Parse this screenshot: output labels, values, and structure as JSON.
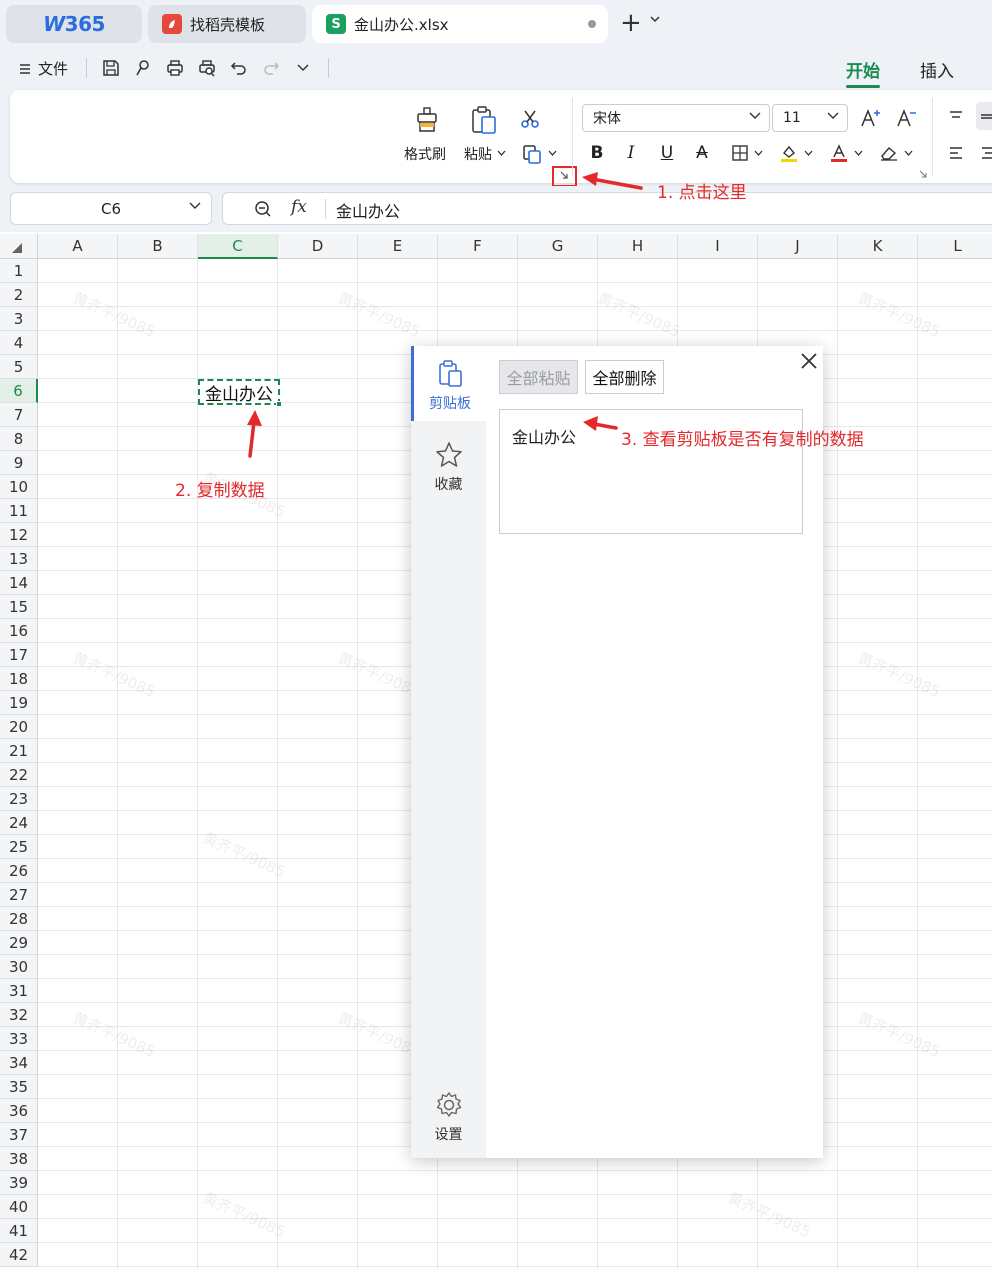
{
  "tabs": [
    {
      "label": "365",
      "logo": "W"
    },
    {
      "label": "找稻壳模板",
      "icon": "docer-icon"
    },
    {
      "label": "金山办公.xlsx",
      "icon": "S"
    }
  ],
  "menu": {
    "file_label": "文件",
    "tabs": [
      "开始",
      "插入"
    ],
    "active_tab": "开始"
  },
  "ribbon": {
    "format_painter": "格式刷",
    "paste": "粘贴",
    "font_name": "宋体",
    "font_size": "11"
  },
  "formula_bar": {
    "cell_ref": "C6",
    "fx": "fx",
    "value": "金山办公"
  },
  "grid": {
    "columns": [
      "A",
      "B",
      "C",
      "D",
      "E",
      "F",
      "G",
      "H",
      "I",
      "J",
      "K",
      "L"
    ],
    "rows": [
      "1",
      "2",
      "3",
      "4",
      "5",
      "6",
      "7",
      "8",
      "9",
      "10",
      "11",
      "12",
      "13",
      "14",
      "15",
      "16",
      "17",
      "18",
      "19",
      "20",
      "21",
      "22",
      "23",
      "24",
      "25",
      "26",
      "27",
      "28",
      "29",
      "30",
      "31",
      "32",
      "33",
      "34",
      "35",
      "36",
      "37",
      "38",
      "39",
      "40",
      "41",
      "42"
    ],
    "selected_col": "C",
    "selected_row": "6",
    "cell_c6": "金山办公",
    "watermark": "黄齐平/9085"
  },
  "clipboard_panel": {
    "side": {
      "clipboard": "剪贴板",
      "favorites": "收藏",
      "settings": "设置"
    },
    "paste_all": "全部粘贴",
    "delete_all": "全部删除",
    "items": [
      "金山办公"
    ]
  },
  "annotations": {
    "step1": "1. 点击这里",
    "step2": "2. 复制数据",
    "step3": "3. 查看剪贴板是否有复制的数据"
  },
  "colors": {
    "accent_green": "#1a8a4d",
    "annotation_red": "#e3292b",
    "panel_blue": "#3a6fd8"
  }
}
